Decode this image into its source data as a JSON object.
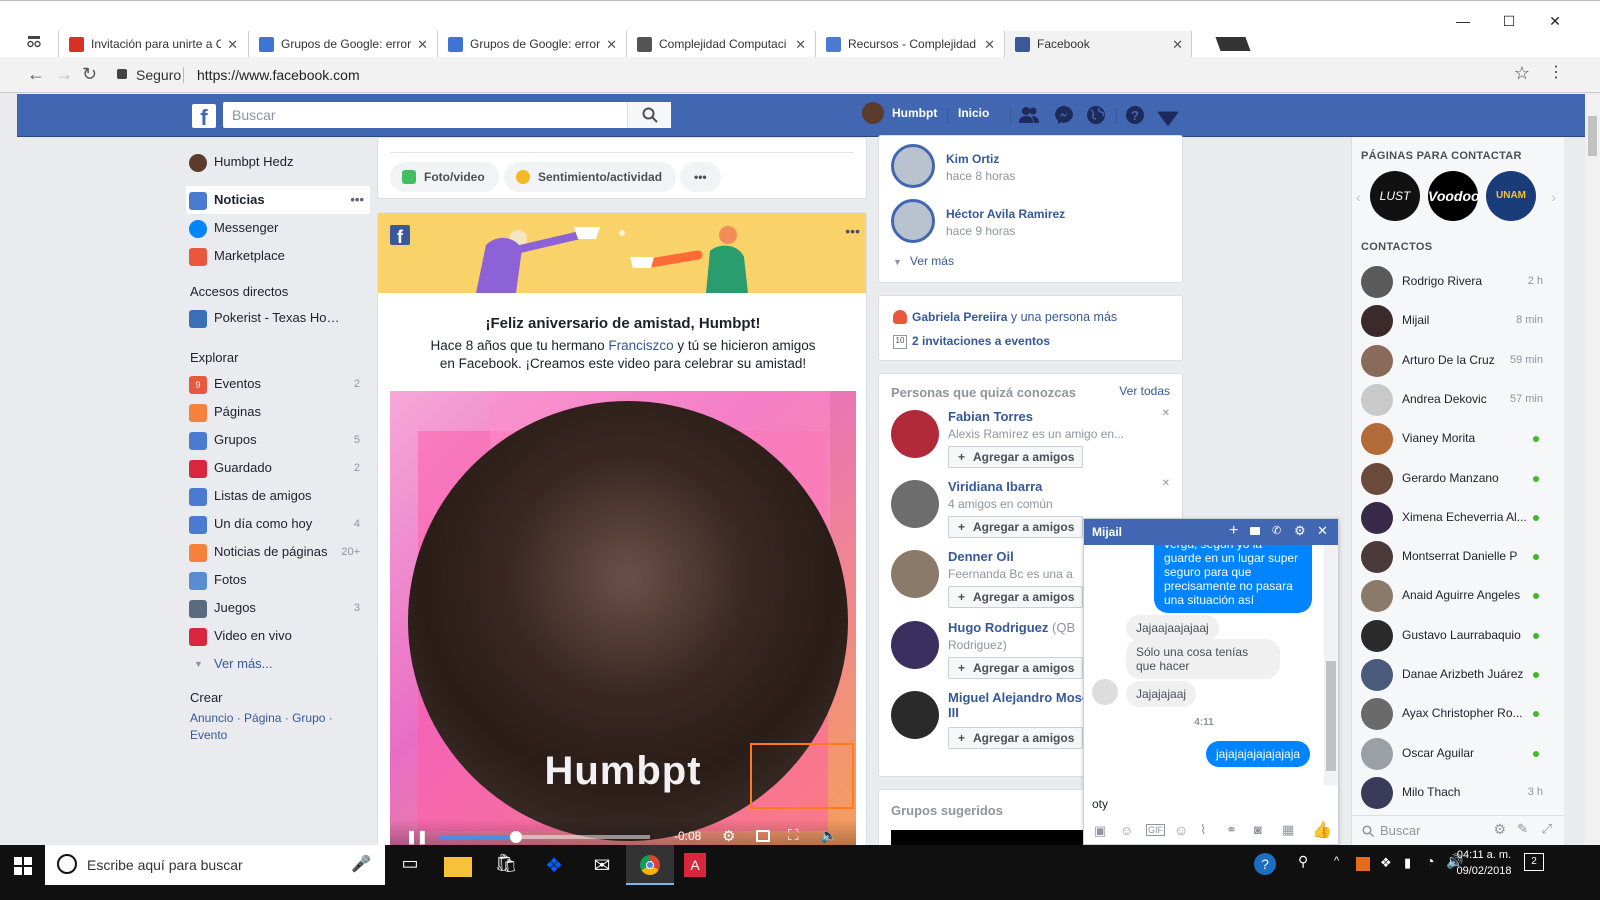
{
  "browser": {
    "tabs": [
      {
        "title": "Invitación para unirte a C",
        "favicon_color": "#d93025"
      },
      {
        "title": "Grupos de Google: error",
        "favicon_color": "#3f74d5"
      },
      {
        "title": "Grupos de Google: error",
        "favicon_color": "#3f74d5"
      },
      {
        "title": "Complejidad Computaci",
        "favicon_color": "#555555"
      },
      {
        "title": "Recursos - Complejidad C",
        "favicon_color": "#4a7bd0"
      },
      {
        "title": "Facebook",
        "favicon_color": "#3b5998",
        "active": true
      }
    ],
    "security_label": "Seguro",
    "url": "https://www.facebook.com"
  },
  "fb": {
    "search_placeholder": "Buscar",
    "user_short": "Humbpt",
    "home_label": "Inicio"
  },
  "left": {
    "profile_name": "Humbpt Hedz",
    "main": [
      {
        "label": "Noticias",
        "icon": "news-feed-icon",
        "selected": true
      },
      {
        "label": "Messenger",
        "icon": "messenger-icon"
      },
      {
        "label": "Marketplace",
        "icon": "marketplace-icon"
      }
    ],
    "shortcuts_title": "Accesos directos",
    "shortcuts": [
      {
        "label": "Pokerist - Texas Ho…"
      }
    ],
    "explore_title": "Explorar",
    "explore": [
      {
        "label": "Eventos",
        "count": "2",
        "icon_color": "#e9573f",
        "icon_text": "9"
      },
      {
        "label": "Páginas",
        "count": "",
        "icon_color": "#f5823b"
      },
      {
        "label": "Grupos",
        "count": "5",
        "icon_color": "#4a7bd0"
      },
      {
        "label": "Guardado",
        "count": "2",
        "icon_color": "#d7263d"
      },
      {
        "label": "Listas de amigos",
        "count": "",
        "icon_color": "#4a7bd0"
      },
      {
        "label": "Un día como hoy",
        "count": "4",
        "icon_color": "#4a7bd0"
      },
      {
        "label": "Noticias de páginas",
        "count": "20+",
        "icon_color": "#f5823b"
      },
      {
        "label": "Fotos",
        "count": "",
        "icon_color": "#5b8bd0"
      },
      {
        "label": "Juegos",
        "count": "3",
        "icon_color": "#5b6b7f"
      },
      {
        "label": "Video en vivo",
        "count": "",
        "icon_color": "#d7263d"
      }
    ],
    "see_more": "Ver más...",
    "create_title": "Crear",
    "create_links": [
      "Anuncio",
      "Página",
      "Grupo",
      "Evento"
    ]
  },
  "composer": {
    "photo_video": "Foto/video",
    "feeling": "Sentimiento/actividad",
    "more": "•••"
  },
  "anniversary": {
    "title": "¡Feliz aniversario de amistad, Humbpt!",
    "text_before": "Hace 8 años que tu hermano ",
    "friend_link": "Franciszco",
    "text_after": " y tú se hicieron amigos en Facebook. ¡Creamos este video para celebrar su amistad!",
    "video_name": "Humbpt",
    "video_time": "-0:08",
    "video_progress": 0.36
  },
  "right": {
    "activity": [
      {
        "name": "Kim Ortiz",
        "time": "hace 8 horas"
      },
      {
        "name": "Héctor Avila Ramirez",
        "time": "hace 9 horas"
      }
    ],
    "activity_more": "Ver más",
    "events": {
      "line1_name": "Gabriela Pereiira",
      "line1_rest": " y una persona más",
      "line2": "2 invitaciones a eventos",
      "cal_num": "10"
    },
    "pymk_title": "Personas que quizá conozcas",
    "pymk_all": "Ver todas",
    "add_label": "Agregar a amigos",
    "pymk": [
      {
        "name": "Fabian Torres",
        "sub": "Alexis Ramírez es un amigo en...",
        "name_extra": ""
      },
      {
        "name": "Viridiana Ibarra",
        "sub": "4 amigos en común",
        "name_extra": ""
      },
      {
        "name": "Denner Oil",
        "sub": "Feernanda Bc es una a",
        "name_extra": ""
      },
      {
        "name": "Hugo Rodriguez",
        "sub": "Rodriguez)",
        "name_extra": " (QB"
      },
      {
        "name": "Miguel Alejandro Mosc",
        "sub": "",
        "name_extra": "III"
      }
    ],
    "groups_title": "Grupos sugeridos"
  },
  "contacts": {
    "pages_title": "PÁGINAS PARA CONTACTAR",
    "pages": [
      "LUST",
      "Voodoo",
      "UNAM"
    ],
    "title": "CONTACTOS",
    "search_placeholder": "Buscar",
    "list": [
      {
        "name": "Rodrigo Rivera",
        "status": "2 h",
        "online": false
      },
      {
        "name": "Mijail",
        "status": "8 min",
        "online": false
      },
      {
        "name": "Arturo De la Cruz",
        "status": "59 min",
        "online": false
      },
      {
        "name": "Andrea Dekovic",
        "status": "57 min",
        "online": false
      },
      {
        "name": "Vianey Morita",
        "status": "",
        "online": true
      },
      {
        "name": "Gerardo Manzano",
        "status": "",
        "online": true
      },
      {
        "name": "Ximena Echeverria Al...",
        "status": "",
        "online": true
      },
      {
        "name": "Montserrat Danielle P",
        "status": "",
        "online": true
      },
      {
        "name": "Anaid Aguirre Angeles",
        "status": "",
        "online": true
      },
      {
        "name": "Gustavo Laurrabaquio",
        "status": "",
        "online": true
      },
      {
        "name": "Danae Arizbeth Juárez",
        "status": "",
        "online": true
      },
      {
        "name": "Ayax Christopher Ro...",
        "status": "",
        "online": true
      },
      {
        "name": "Oscar Aguilar",
        "status": "",
        "online": true
      },
      {
        "name": "Milo Thach",
        "status": "3 h",
        "online": false
      }
    ]
  },
  "chat": {
    "contact": "Mijail",
    "messages_top": "verga, según yo la guarde en un lugar super seguro para que precisamente no pasara una situación así",
    "m1": "Jajaajaajajaaj",
    "m2": "Sólo una cosa tenías que hacer",
    "m3": "Jajajajaaj",
    "time": "4:11",
    "m4": "jajajajajajajajaja",
    "draft": "oty"
  },
  "taskbar": {
    "search_placeholder": "Escribe aquí para buscar",
    "time": "04:11 a. m.",
    "date": "09/02/2018",
    "notif_count": "2"
  }
}
